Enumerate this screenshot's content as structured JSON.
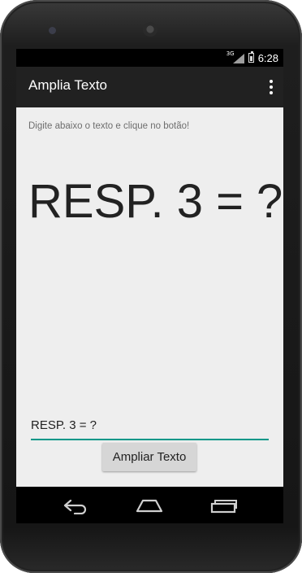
{
  "status_bar": {
    "network": "3G",
    "time": "6:28"
  },
  "app_bar": {
    "title": "Amplia Texto",
    "overflow_icon": "overflow-menu-icon"
  },
  "main": {
    "instruction": "Digite abaixo o texto e clique no botão!",
    "display_text": "RESP. 3 = ?",
    "input_value": "RESP. 3 = ?",
    "button_label": "Ampliar Texto"
  },
  "navigation": {
    "back_icon": "back-icon",
    "home_icon": "home-icon",
    "recents_icon": "recent-apps-icon"
  },
  "colors": {
    "accent": "#009688",
    "app_bar": "#212121",
    "background": "#eeeeee",
    "button": "#d6d6d6"
  }
}
